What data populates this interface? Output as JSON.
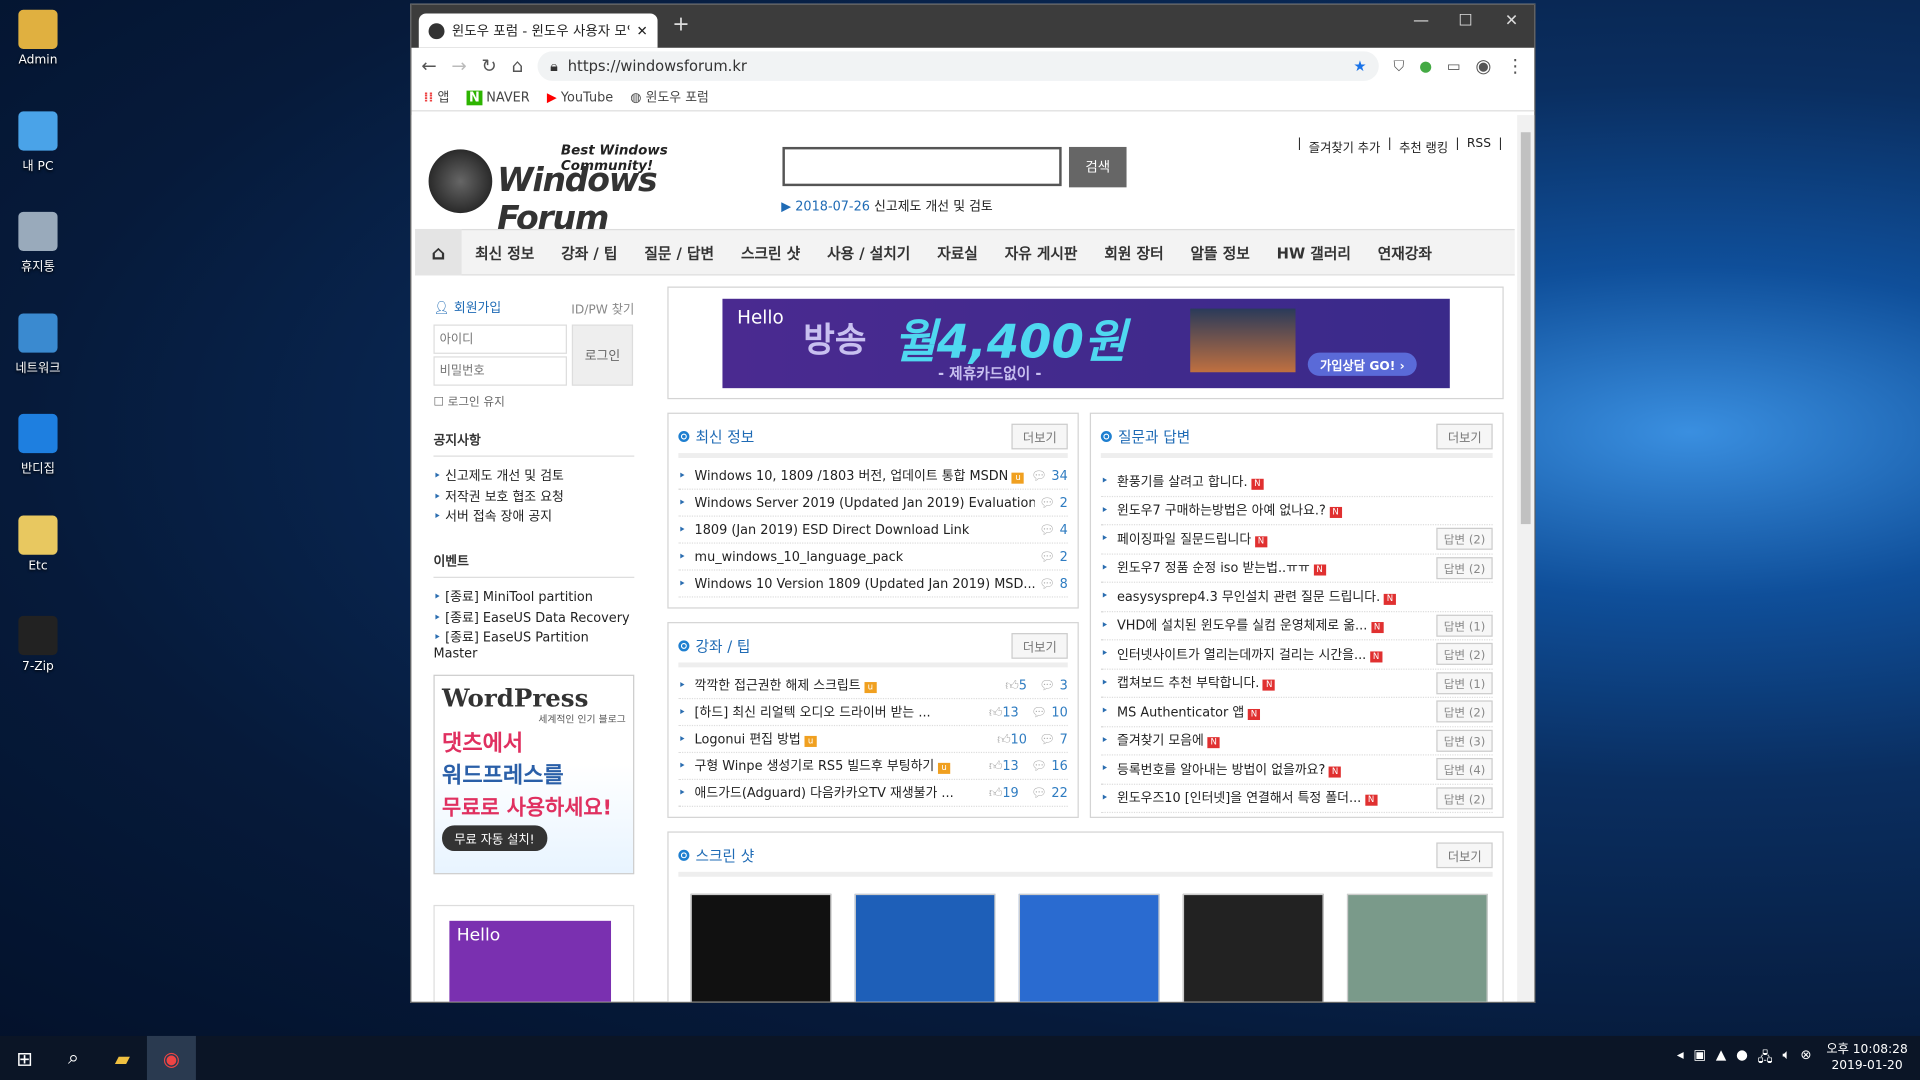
{
  "desktop": {
    "icons": [
      {
        "label": "Admin",
        "color": "#e0b040"
      },
      {
        "label": "내 PC",
        "color": "#4aa3e8"
      },
      {
        "label": "휴지통",
        "color": "#9ab"
      },
      {
        "label": "네트워크",
        "color": "#3a8ad0"
      },
      {
        "label": "반디집",
        "color": "#1e7fe0"
      },
      {
        "label": "Etc",
        "color": "#e8c860"
      },
      {
        "label": "7-Zip",
        "color": "#222"
      }
    ]
  },
  "browser": {
    "tab_title": "윈도우 포럼 - 윈도우 사용자 모임",
    "new_tab": "+",
    "url": "https://windowsforum.kr",
    "bookmarks": [
      "앱",
      "NAVER",
      "YouTube",
      "윈도우 포럼"
    ]
  },
  "site": {
    "tagline": "Best Windows Community!",
    "logo": "Windows Forum",
    "search_button": "검색",
    "notice_date": "2018-07-26",
    "notice_text": "신고제도 개선 및 검토",
    "top_links": [
      "즐겨찾기 추가",
      "추천 랭킹",
      "RSS"
    ],
    "nav": [
      "최신 정보",
      "강좌 / 팁",
      "질문 / 답변",
      "스크린 샷",
      "사용 / 설치기",
      "자료실",
      "자유 게시판",
      "회원 장터",
      "알뜰 정보",
      "HW 갤러리",
      "연재강좌"
    ],
    "login": {
      "signup": "회원가입",
      "find": "ID/PW 찾기",
      "id_placeholder": "아이디",
      "pw_placeholder": "비밀번호",
      "button": "로그인",
      "keep": "로그인 유지"
    },
    "notice": {
      "title": "공지사항",
      "items": [
        "신고제도 개선 및 검토",
        "저작권 보호 협조 요청",
        "서버 접속 장애 공지"
      ]
    },
    "event": {
      "title": "이벤트",
      "items": [
        "[종료] MiniTool partition",
        "[종료] EaseUS Data Recovery",
        "[종료] EaseUS Partition Master"
      ]
    },
    "ad_banner": {
      "brand": "Hello",
      "text1": "방송",
      "text2": "월4,400원",
      "text3": "- 제휴카드없이 -",
      "cta": "가입상담 GO! ›"
    },
    "wp_ad": {
      "logo": "WordPress",
      "sub": "세계적인 인기 블로그",
      "line1": "댓츠에서",
      "line2": "워드프레스를",
      "line3": "무료로 사용하세요!",
      "cta": "무료 자동 설치!"
    },
    "more": "더보기",
    "latest": {
      "title": "최신 정보",
      "items": [
        {
          "t": "Windows 10, 1809 /1803 버전, 업데이트 통합 MSDN",
          "c": "34",
          "badge": "u"
        },
        {
          "t": "Windows Server 2019 (Updated Jan 2019) Evaluation",
          "c": "2"
        },
        {
          "t": "1809 (Jan 2019) ESD Direct Download Link",
          "c": "4"
        },
        {
          "t": "mu_windows_10_language_pack",
          "c": "2"
        },
        {
          "t": "Windows 10 Version 1809 (Updated Jan 2019) MSD...",
          "c": "8"
        }
      ]
    },
    "tips": {
      "title": "강좌 / 팁",
      "items": [
        {
          "t": "깍깍한 접근권한 해제 스크립트",
          "l": "5",
          "c": "3",
          "badge": "u"
        },
        {
          "t": "[하드] 최신 리얼텍 오디오 드라이버 받는 ...",
          "l": "13",
          "c": "10"
        },
        {
          "t": "Logonui 편집 방법",
          "l": "10",
          "c": "7",
          "badge": "u"
        },
        {
          "t": "구형 Winpe 생성기로 RS5 빌드후 부팅하기",
          "l": "13",
          "c": "16",
          "badge": "u"
        },
        {
          "t": "애드가드(Adguard) 다음카카오TV 재생불가 ...",
          "l": "19",
          "c": "22"
        }
      ]
    },
    "qna": {
      "title": "질문과 답변",
      "items": [
        {
          "t": "환풍기를 살려고 합니다.",
          "a": ""
        },
        {
          "t": "윈도우7 구매하는방법은 아예 없나요.?",
          "a": ""
        },
        {
          "t": "페이징파일 질문드립니다",
          "a": "답변 (2)"
        },
        {
          "t": "윈도우7 정품 순정 iso 받는법..ㅠㅠ",
          "a": "답변 (2)"
        },
        {
          "t": "easysysprep4.3 무인설치 관련 질문 드립니다.",
          "a": ""
        },
        {
          "t": "VHD에 설치된 윈도우를 실컴 운영체제로 옮...",
          "a": "답변 (1)"
        },
        {
          "t": "인터넷사이트가 열리는데까지 걸리는 시간을...",
          "a": "답변 (2)"
        },
        {
          "t": "캡쳐보드 추천 부탁합니다.",
          "a": "답변 (1)"
        },
        {
          "t": "MS Authenticator 앱",
          "a": "답변 (2)"
        },
        {
          "t": "즐겨찾기 모음에",
          "a": "답변 (3)"
        },
        {
          "t": "등록번호를 알아내는 방법이 없을까요?",
          "a": "답변 (4)"
        },
        {
          "t": "윈도우즈10 [인터넷]을 연결해서 특정 폴더...",
          "a": "답변 (2)"
        }
      ]
    },
    "screenshots": {
      "title": "스크린 샷",
      "thumb_colors": [
        "#111",
        "#1e5fb8",
        "#2a6bd0",
        "#222",
        "#7a9a8a"
      ]
    }
  },
  "taskbar": {
    "time": "오후 10:08:28",
    "date": "2019-01-20"
  },
  "colors": {
    "accent": "#1f6bb5",
    "new_badge": "#e03030",
    "u_badge": "#f0a020"
  }
}
